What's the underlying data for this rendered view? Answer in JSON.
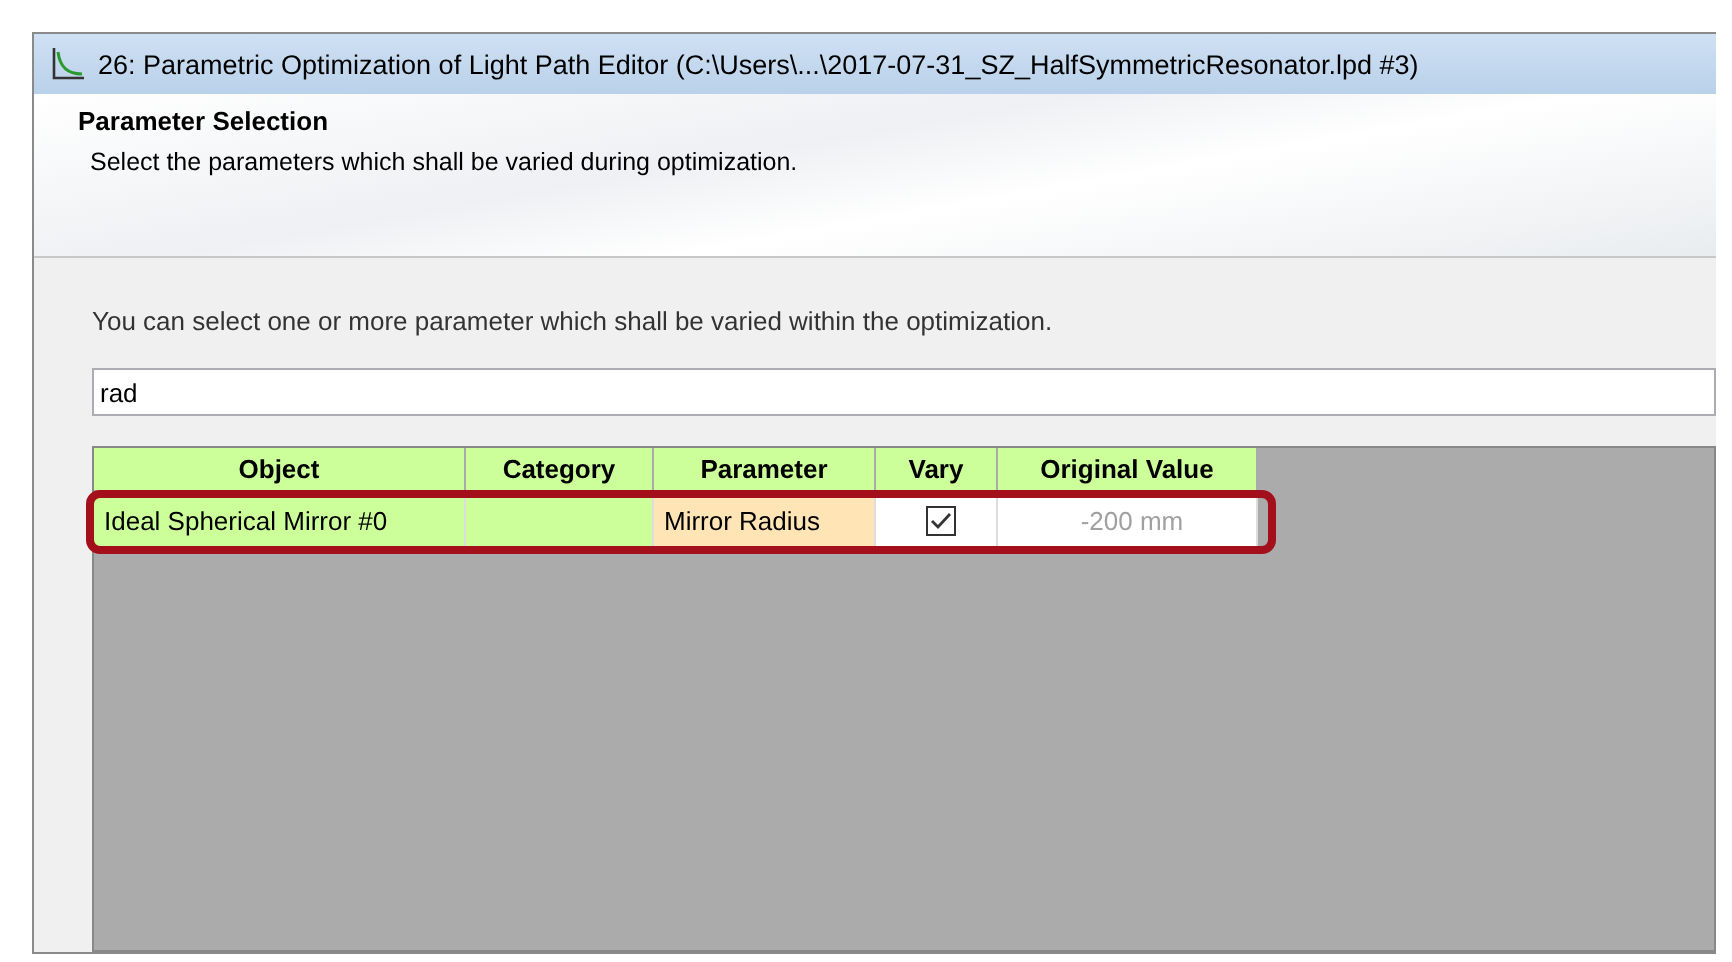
{
  "window": {
    "title": "26: Parametric Optimization of Light Path Editor (C:\\Users\\...\\2017-07-31_SZ_HalfSymmetricResonator.lpd #3)"
  },
  "header": {
    "title": "Parameter Selection",
    "subtitle": "Select the parameters which shall be varied during optimization."
  },
  "instruction": "You can select one or more parameter which shall be varied within the optimization.",
  "search": {
    "value": "rad"
  },
  "table": {
    "columns": [
      {
        "label": "Object"
      },
      {
        "label": "Category"
      },
      {
        "label": "Parameter"
      },
      {
        "label": "Vary"
      },
      {
        "label": "Original Value"
      }
    ],
    "rows": [
      {
        "highlighted": true,
        "cells": [
          {
            "kind": "text",
            "text": "Ideal Spherical Mirror #0",
            "color": "#ccff99",
            "disabled": false
          },
          {
            "kind": "text",
            "color": "#ccff99"
          },
          {
            "kind": "text",
            "text": "Mirror Radius",
            "color": "#ffe4b5",
            "disabled": false
          },
          {
            "kind": "checkbox",
            "checked": true,
            "color": "#ffffff"
          },
          {
            "kind": "text",
            "text": "-200 mm",
            "color": "#ffffff",
            "disabled": true
          }
        ]
      }
    ]
  }
}
